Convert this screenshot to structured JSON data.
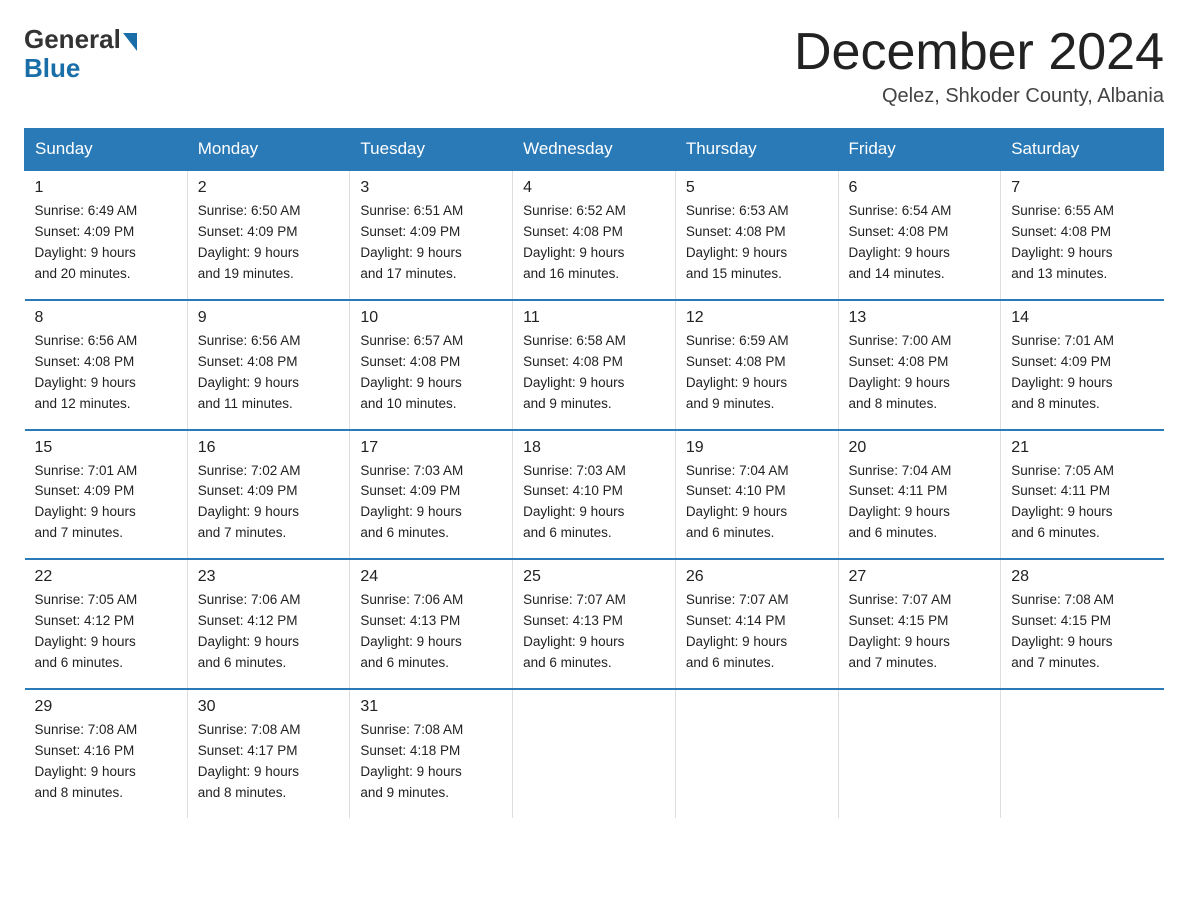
{
  "logo": {
    "general": "General",
    "blue": "Blue"
  },
  "title": "December 2024",
  "location": "Qelez, Shkoder County, Albania",
  "days_of_week": [
    "Sunday",
    "Monday",
    "Tuesday",
    "Wednesday",
    "Thursday",
    "Friday",
    "Saturday"
  ],
  "weeks": [
    [
      {
        "day": "1",
        "sunrise": "6:49 AM",
        "sunset": "4:09 PM",
        "daylight": "9 hours and 20 minutes."
      },
      {
        "day": "2",
        "sunrise": "6:50 AM",
        "sunset": "4:09 PM",
        "daylight": "9 hours and 19 minutes."
      },
      {
        "day": "3",
        "sunrise": "6:51 AM",
        "sunset": "4:09 PM",
        "daylight": "9 hours and 17 minutes."
      },
      {
        "day": "4",
        "sunrise": "6:52 AM",
        "sunset": "4:08 PM",
        "daylight": "9 hours and 16 minutes."
      },
      {
        "day": "5",
        "sunrise": "6:53 AM",
        "sunset": "4:08 PM",
        "daylight": "9 hours and 15 minutes."
      },
      {
        "day": "6",
        "sunrise": "6:54 AM",
        "sunset": "4:08 PM",
        "daylight": "9 hours and 14 minutes."
      },
      {
        "day": "7",
        "sunrise": "6:55 AM",
        "sunset": "4:08 PM",
        "daylight": "9 hours and 13 minutes."
      }
    ],
    [
      {
        "day": "8",
        "sunrise": "6:56 AM",
        "sunset": "4:08 PM",
        "daylight": "9 hours and 12 minutes."
      },
      {
        "day": "9",
        "sunrise": "6:56 AM",
        "sunset": "4:08 PM",
        "daylight": "9 hours and 11 minutes."
      },
      {
        "day": "10",
        "sunrise": "6:57 AM",
        "sunset": "4:08 PM",
        "daylight": "9 hours and 10 minutes."
      },
      {
        "day": "11",
        "sunrise": "6:58 AM",
        "sunset": "4:08 PM",
        "daylight": "9 hours and 9 minutes."
      },
      {
        "day": "12",
        "sunrise": "6:59 AM",
        "sunset": "4:08 PM",
        "daylight": "9 hours and 9 minutes."
      },
      {
        "day": "13",
        "sunrise": "7:00 AM",
        "sunset": "4:08 PM",
        "daylight": "9 hours and 8 minutes."
      },
      {
        "day": "14",
        "sunrise": "7:01 AM",
        "sunset": "4:09 PM",
        "daylight": "9 hours and 8 minutes."
      }
    ],
    [
      {
        "day": "15",
        "sunrise": "7:01 AM",
        "sunset": "4:09 PM",
        "daylight": "9 hours and 7 minutes."
      },
      {
        "day": "16",
        "sunrise": "7:02 AM",
        "sunset": "4:09 PM",
        "daylight": "9 hours and 7 minutes."
      },
      {
        "day": "17",
        "sunrise": "7:03 AM",
        "sunset": "4:09 PM",
        "daylight": "9 hours and 6 minutes."
      },
      {
        "day": "18",
        "sunrise": "7:03 AM",
        "sunset": "4:10 PM",
        "daylight": "9 hours and 6 minutes."
      },
      {
        "day": "19",
        "sunrise": "7:04 AM",
        "sunset": "4:10 PM",
        "daylight": "9 hours and 6 minutes."
      },
      {
        "day": "20",
        "sunrise": "7:04 AM",
        "sunset": "4:11 PM",
        "daylight": "9 hours and 6 minutes."
      },
      {
        "day": "21",
        "sunrise": "7:05 AM",
        "sunset": "4:11 PM",
        "daylight": "9 hours and 6 minutes."
      }
    ],
    [
      {
        "day": "22",
        "sunrise": "7:05 AM",
        "sunset": "4:12 PM",
        "daylight": "9 hours and 6 minutes."
      },
      {
        "day": "23",
        "sunrise": "7:06 AM",
        "sunset": "4:12 PM",
        "daylight": "9 hours and 6 minutes."
      },
      {
        "day": "24",
        "sunrise": "7:06 AM",
        "sunset": "4:13 PM",
        "daylight": "9 hours and 6 minutes."
      },
      {
        "day": "25",
        "sunrise": "7:07 AM",
        "sunset": "4:13 PM",
        "daylight": "9 hours and 6 minutes."
      },
      {
        "day": "26",
        "sunrise": "7:07 AM",
        "sunset": "4:14 PM",
        "daylight": "9 hours and 6 minutes."
      },
      {
        "day": "27",
        "sunrise": "7:07 AM",
        "sunset": "4:15 PM",
        "daylight": "9 hours and 7 minutes."
      },
      {
        "day": "28",
        "sunrise": "7:08 AM",
        "sunset": "4:15 PM",
        "daylight": "9 hours and 7 minutes."
      }
    ],
    [
      {
        "day": "29",
        "sunrise": "7:08 AM",
        "sunset": "4:16 PM",
        "daylight": "9 hours and 8 minutes."
      },
      {
        "day": "30",
        "sunrise": "7:08 AM",
        "sunset": "4:17 PM",
        "daylight": "9 hours and 8 minutes."
      },
      {
        "day": "31",
        "sunrise": "7:08 AM",
        "sunset": "4:18 PM",
        "daylight": "9 hours and 9 minutes."
      },
      null,
      null,
      null,
      null
    ]
  ],
  "labels": {
    "sunrise": "Sunrise:",
    "sunset": "Sunset:",
    "daylight": "Daylight:"
  }
}
